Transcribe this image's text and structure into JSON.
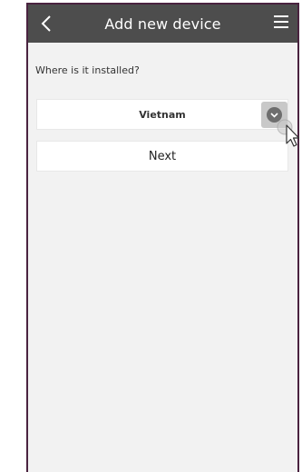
{
  "header": {
    "title": "Add new device",
    "back_icon": "chevron-left-icon",
    "menu_icon": "hamburger-menu-icon"
  },
  "form": {
    "question": "Where is it installed?",
    "country_select": {
      "selected": "Vietnam",
      "icon": "chevron-down-icon"
    },
    "next_label": "Next"
  },
  "colors": {
    "header_bg": "#4d4d4d",
    "frame_border": "#4a2340",
    "content_bg": "#f2f2f2"
  }
}
